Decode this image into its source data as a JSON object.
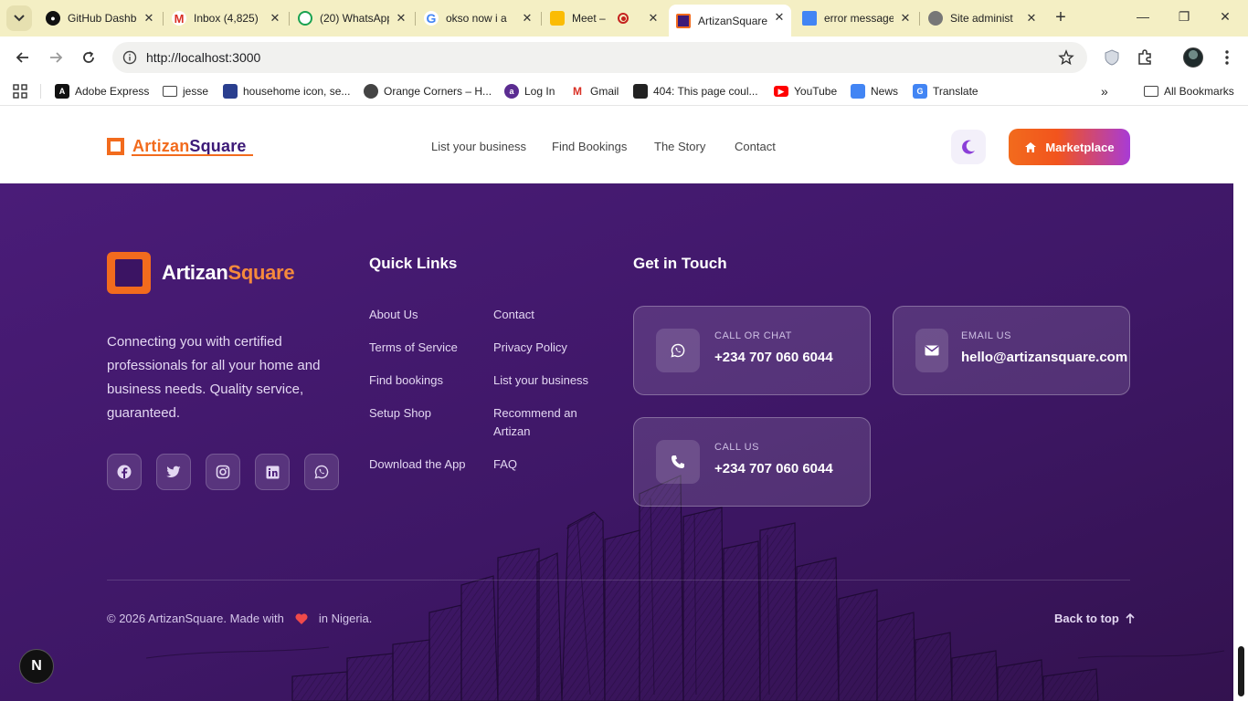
{
  "browser": {
    "tabs": [
      {
        "title": "GitHub Dashboard",
        "icon": "github-icon"
      },
      {
        "title": "Inbox (4,825)",
        "icon": "gmail-icon"
      },
      {
        "title": "(20) WhatsApp",
        "icon": "whatsapp-icon"
      },
      {
        "title": "okso now i a",
        "icon": "google-icon"
      },
      {
        "title": "Meet – v",
        "icon": "meet-icon"
      },
      {
        "title": "ArtizanSquare",
        "icon": "artizan-icon"
      },
      {
        "title": "error message",
        "icon": "docs-icon"
      },
      {
        "title": "Site administ",
        "icon": "globe-icon"
      }
    ],
    "url": "http://localhost:3000",
    "bookmarks": [
      {
        "label": "Adobe Express"
      },
      {
        "label": "jesse"
      },
      {
        "label": "househome icon, se..."
      },
      {
        "label": "Orange Corners – H..."
      },
      {
        "label": "Log In"
      },
      {
        "label": "Gmail"
      },
      {
        "label": "404: This page coul..."
      },
      {
        "label": "YouTube"
      },
      {
        "label": "News"
      },
      {
        "label": "Translate"
      }
    ],
    "all_bookmarks": "All Bookmarks"
  },
  "header": {
    "logo": {
      "part1": "Artizan",
      "part2": "Square"
    },
    "nav": [
      "List your business",
      "Find Bookings",
      "The Story",
      "Contact"
    ],
    "marketplace_label": "Marketplace"
  },
  "footer": {
    "logo": {
      "part1": "Artizan",
      "part2": "Square"
    },
    "description": "Connecting you with certified professionals for all your home and business needs. Quality service, guaranteed.",
    "socials": [
      "facebook-icon",
      "twitter-icon",
      "instagram-icon",
      "linkedin-icon",
      "whatsapp-icon"
    ],
    "quick_links_title": "Quick Links",
    "quick_links": {
      "col1": [
        "About Us",
        "Terms of Service",
        "Find bookings",
        "Setup Shop",
        "Download the App"
      ],
      "col2": [
        "Contact",
        "Privacy Policy",
        "List your business",
        "Recommend an Artizan",
        "FAQ"
      ]
    },
    "get_in_touch_title": "Get in Touch",
    "contacts": [
      {
        "label": "CALL OR CHAT",
        "value": "+234 707 060 6044",
        "icon": "whatsapp-icon"
      },
      {
        "label": "EMAIL US",
        "value": "hello@artizansquare.com",
        "icon": "mail-icon"
      },
      {
        "label": "CALL US",
        "value": "+234 707 060 6044",
        "icon": "phone-icon"
      }
    ],
    "copyright_prefix": "© 2026 ArtizanSquare. Made with",
    "copyright_suffix": "in Nigeria.",
    "back_to_top": "Back to top"
  },
  "dev": {
    "badge": "N"
  },
  "colors": {
    "accent_orange": "#f26b1d",
    "brand_purple": "#3d1a78",
    "footer_bg": "#4a1c78",
    "heart": "#f04a4a",
    "chrome_tabstrip": "#f4efc4"
  }
}
